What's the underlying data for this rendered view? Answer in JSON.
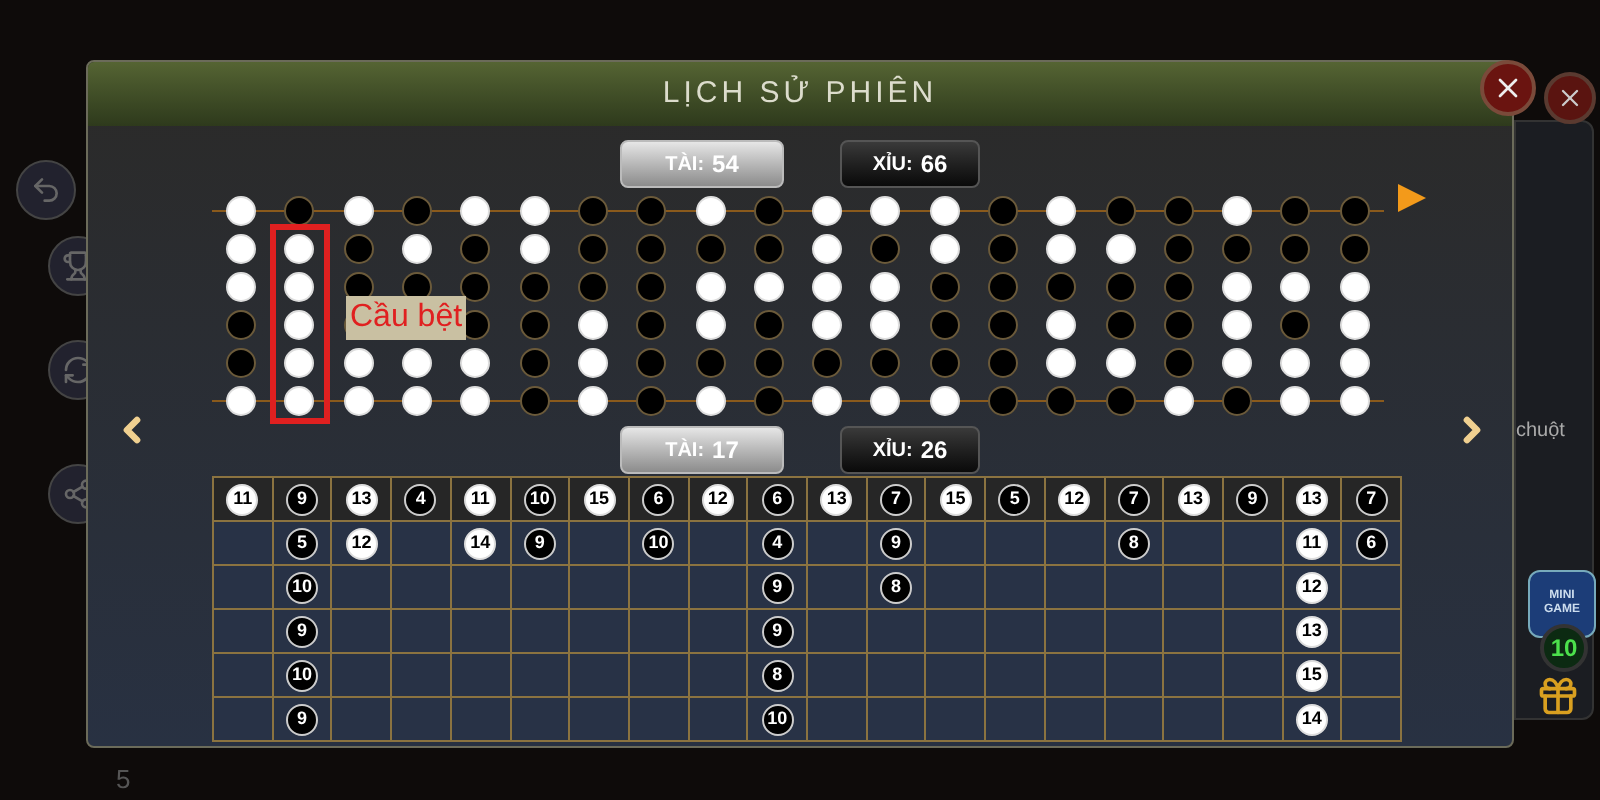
{
  "window": {
    "title": "LỊCH SỬ PHIÊN"
  },
  "bead_summary": [
    {
      "label": "TÀI:",
      "value": "54",
      "kind": "tai"
    },
    {
      "label": "XỈU:",
      "value": "66",
      "kind": "xiu"
    }
  ],
  "bead_road": [
    {
      "beads": [
        {
          "tai": true
        },
        {
          "tai": true
        },
        {
          "tai": true
        },
        {
          "tai": false
        },
        {
          "tai": false
        },
        {
          "tai": true
        }
      ]
    },
    {
      "beads": [
        {
          "tai": false
        },
        {
          "tai": true
        },
        {
          "tai": true
        },
        {
          "tai": true
        },
        {
          "tai": true
        },
        {
          "tai": true
        }
      ]
    },
    {
      "beads": [
        {
          "tai": true
        },
        {
          "tai": false
        },
        {
          "tai": false
        },
        {
          "tai": false
        },
        {
          "tai": true
        },
        {
          "tai": true
        }
      ]
    },
    {
      "beads": [
        {
          "tai": false
        },
        {
          "tai": true
        },
        {
          "tai": false
        }
      ],
      "beads_below_label": [
        {
          "tai": true
        },
        {
          "tai": true
        }
      ]
    },
    {
      "beads": [
        {
          "tai": true
        },
        {
          "tai": false
        },
        {
          "tai": false
        },
        {
          "tai": false
        },
        {
          "tai": true
        },
        {
          "tai": true
        }
      ]
    },
    {
      "beads": [
        {
          "tai": true
        },
        {
          "tai": true
        },
        {
          "tai": false
        },
        {
          "tai": false
        },
        {
          "tai": false
        },
        {
          "tai": false
        }
      ]
    },
    {
      "beads": [
        {
          "tai": false
        },
        {
          "tai": false
        },
        {
          "tai": false
        },
        {
          "tai": true
        },
        {
          "tai": true
        },
        {
          "tai": true
        }
      ]
    },
    {
      "beads": [
        {
          "tai": false
        },
        {
          "tai": false
        },
        {
          "tai": false
        },
        {
          "tai": false
        },
        {
          "tai": false
        },
        {
          "tai": false
        }
      ]
    },
    {
      "beads": [
        {
          "tai": true
        },
        {
          "tai": false
        },
        {
          "tai": true
        },
        {
          "tai": true
        },
        {
          "tai": false
        },
        {
          "tai": true
        }
      ]
    },
    {
      "beads": [
        {
          "tai": false
        },
        {
          "tai": false
        },
        {
          "tai": true
        },
        {
          "tai": false
        },
        {
          "tai": false
        },
        {
          "tai": false
        }
      ]
    },
    {
      "beads": [
        {
          "tai": true
        },
        {
          "tai": true
        },
        {
          "tai": true
        },
        {
          "tai": true
        },
        {
          "tai": false
        },
        {
          "tai": true
        }
      ]
    },
    {
      "beads": [
        {
          "tai": true
        },
        {
          "tai": false
        },
        {
          "tai": true
        },
        {
          "tai": true
        },
        {
          "tai": false
        },
        {
          "tai": true
        }
      ]
    },
    {
      "beads": [
        {
          "tai": true
        },
        {
          "tai": true
        },
        {
          "tai": false
        },
        {
          "tai": false
        },
        {
          "tai": false
        },
        {
          "tai": true
        }
      ]
    },
    {
      "beads": [
        {
          "tai": false
        },
        {
          "tai": false
        },
        {
          "tai": false
        },
        {
          "tai": false
        },
        {
          "tai": false
        },
        {
          "tai": false
        }
      ]
    },
    {
      "beads": [
        {
          "tai": true
        },
        {
          "tai": true
        },
        {
          "tai": false
        },
        {
          "tai": true
        },
        {
          "tai": true
        },
        {
          "tai": false
        }
      ]
    },
    {
      "beads": [
        {
          "tai": false
        },
        {
          "tai": true
        },
        {
          "tai": false
        },
        {
          "tai": false
        },
        {
          "tai": true
        },
        {
          "tai": false
        }
      ]
    },
    {
      "beads": [
        {
          "tai": false
        },
        {
          "tai": false
        },
        {
          "tai": false
        },
        {
          "tai": false
        },
        {
          "tai": false
        },
        {
          "tai": true
        }
      ]
    },
    {
      "beads": [
        {
          "tai": true
        },
        {
          "tai": false
        },
        {
          "tai": true
        },
        {
          "tai": true
        },
        {
          "tai": true
        },
        {
          "tai": false
        }
      ]
    },
    {
      "beads": [
        {
          "tai": false
        },
        {
          "tai": false
        },
        {
          "tai": true
        },
        {
          "tai": false
        },
        {
          "tai": true
        },
        {
          "tai": true
        }
      ]
    },
    {
      "beads": [
        {
          "tai": false
        },
        {
          "tai": false
        },
        {
          "tai": true
        },
        {
          "tai": true
        },
        {
          "tai": true
        },
        {
          "tai": true
        }
      ]
    }
  ],
  "annotation": {
    "label": "Cầu bệt"
  },
  "score_summary": [
    {
      "label": "TÀI:",
      "value": "17",
      "kind": "tai"
    },
    {
      "label": "XỈU:",
      "value": "26",
      "kind": "xiu"
    }
  ],
  "score_road": [
    {
      "scores": [
        {
          "value": "11",
          "tai": true
        }
      ]
    },
    {
      "scores": [
        {
          "value": "9",
          "tai": false
        },
        {
          "value": "5",
          "tai": false
        },
        {
          "value": "10",
          "tai": false
        },
        {
          "value": "9",
          "tai": false
        },
        {
          "value": "10",
          "tai": false
        },
        {
          "value": "9",
          "tai": false
        }
      ]
    },
    {
      "scores": [
        {
          "value": "13",
          "tai": true
        },
        {
          "value": "12",
          "tai": true
        }
      ]
    },
    {
      "scores": [
        {
          "value": "4",
          "tai": false
        }
      ]
    },
    {
      "scores": [
        {
          "value": "11",
          "tai": true
        },
        {
          "value": "14",
          "tai": true
        }
      ]
    },
    {
      "scores": [
        {
          "value": "10",
          "tai": false
        },
        {
          "value": "9",
          "tai": false
        }
      ]
    },
    {
      "scores": [
        {
          "value": "15",
          "tai": true
        }
      ]
    },
    {
      "scores": [
        {
          "value": "6",
          "tai": false
        },
        {
          "value": "10",
          "tai": false
        }
      ]
    },
    {
      "scores": [
        {
          "value": "12",
          "tai": true
        }
      ]
    },
    {
      "scores": [
        {
          "value": "6",
          "tai": false
        },
        {
          "value": "4",
          "tai": false
        },
        {
          "value": "9",
          "tai": false
        },
        {
          "value": "9",
          "tai": false
        },
        {
          "value": "8",
          "tai": false
        },
        {
          "value": "10",
          "tai": false
        }
      ]
    },
    {
      "scores": [
        {
          "value": "13",
          "tai": true
        }
      ]
    },
    {
      "scores": [
        {
          "value": "7",
          "tai": false
        },
        {
          "value": "9",
          "tai": false
        },
        {
          "value": "8",
          "tai": false
        }
      ]
    },
    {
      "scores": [
        {
          "value": "15",
          "tai": true
        }
      ]
    },
    {
      "scores": [
        {
          "value": "5",
          "tai": false
        }
      ]
    },
    {
      "scores": [
        {
          "value": "12",
          "tai": true
        }
      ]
    },
    {
      "scores": [
        {
          "value": "7",
          "tai": false
        },
        {
          "value": "8",
          "tai": false
        }
      ]
    },
    {
      "scores": [
        {
          "value": "13",
          "tai": true
        }
      ]
    },
    {
      "scores": [
        {
          "value": "9",
          "tai": false
        }
      ]
    },
    {
      "scores": [
        {
          "value": "13",
          "tai": true
        },
        {
          "value": "11",
          "tai": true
        },
        {
          "value": "12",
          "tai": true
        },
        {
          "value": "13",
          "tai": true
        },
        {
          "value": "15",
          "tai": true
        },
        {
          "value": "14",
          "tai": true
        }
      ]
    },
    {
      "scores": [
        {
          "value": "7",
          "tai": false
        },
        {
          "value": "6",
          "tai": false
        }
      ]
    }
  ],
  "background": {
    "side_text": "chuột",
    "mini_game": {
      "label": "MINI GAME",
      "count": "10"
    },
    "bottom_text": "5"
  }
}
